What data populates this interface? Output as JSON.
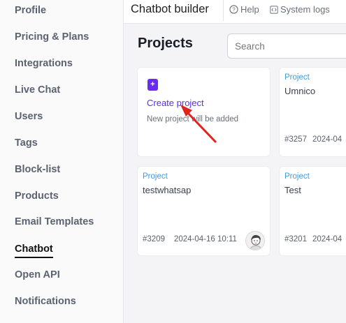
{
  "sidebar": {
    "items": [
      {
        "label": "Profile"
      },
      {
        "label": "Pricing & Plans"
      },
      {
        "label": "Integrations"
      },
      {
        "label": "Live Chat"
      },
      {
        "label": "Users"
      },
      {
        "label": "Tags"
      },
      {
        "label": "Block-list"
      },
      {
        "label": "Products"
      },
      {
        "label": "Email Templates"
      },
      {
        "label": "Chatbot",
        "active": true
      },
      {
        "label": "Open API"
      },
      {
        "label": "Notifications"
      }
    ]
  },
  "topbar": {
    "title": "Chatbot builder",
    "help": "Help",
    "system_logs": "System logs",
    "help_icon": "question-circle-icon",
    "logs_icon": "code-icon"
  },
  "main": {
    "title": "Projects",
    "search": {
      "placeholder": "Search"
    },
    "create_card": {
      "button_symbol": "+",
      "link": "Create project",
      "hint": "New project will be added"
    },
    "projects": [
      {
        "label": "Project",
        "name": "Umnico",
        "id": "#3257",
        "date": "2024-04"
      },
      {
        "label": "Project",
        "name": "testwhatsap",
        "id": "#3209",
        "date": "2024-04-16 10:11"
      },
      {
        "label": "Project",
        "name": "Test",
        "id": "#3201",
        "date": "2024-04"
      }
    ]
  },
  "colors": {
    "accent": "#6a2cf5",
    "project_label": "#3f9be0",
    "annotation_arrow": "#e0231c"
  }
}
